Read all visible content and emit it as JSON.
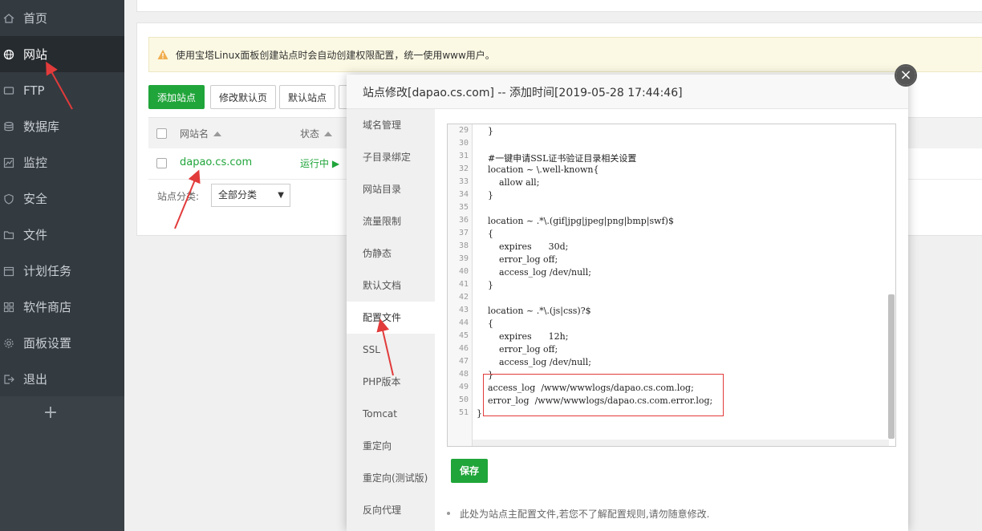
{
  "sidebar": {
    "items": [
      {
        "label": "首页",
        "icon": "home-icon"
      },
      {
        "label": "网站",
        "icon": "globe-icon"
      },
      {
        "label": "FTP",
        "icon": "ftp-icon"
      },
      {
        "label": "数据库",
        "icon": "database-icon"
      },
      {
        "label": "监控",
        "icon": "monitor-icon"
      },
      {
        "label": "安全",
        "icon": "shield-icon"
      },
      {
        "label": "文件",
        "icon": "folder-icon"
      },
      {
        "label": "计划任务",
        "icon": "calendar-icon"
      },
      {
        "label": "软件商店",
        "icon": "apps-icon"
      },
      {
        "label": "面板设置",
        "icon": "gear-icon"
      },
      {
        "label": "退出",
        "icon": "logout-icon"
      }
    ],
    "add": "+"
  },
  "notice": {
    "text": "使用宝塔Linux面板创建站点时会自动创建权限配置，统一使用www用户。"
  },
  "toolbar": {
    "add_site": "添加站点",
    "modify_default_page": "修改默认页",
    "default_site": "默认站点"
  },
  "table": {
    "headers": {
      "site_name": "网站名",
      "status": "状态"
    },
    "row": {
      "site": "dapao.cs.com",
      "status": "运行中 ▶"
    }
  },
  "category": {
    "label": "站点分类:",
    "selected": "全部分类"
  },
  "modal": {
    "title": "站点修改[dapao.cs.com] -- 添加时间[2019-05-28 17:44:46]",
    "tabs": [
      "域名管理",
      "子目录绑定",
      "网站目录",
      "流量限制",
      "伪静态",
      "默认文档",
      "配置文件",
      "SSL",
      "PHP版本",
      "Tomcat",
      "重定向",
      "重定向(测试版)",
      "反向代理"
    ],
    "active_tab": "配置文件",
    "editor": {
      "lines": [
        {
          "n": "29",
          "text": "    }"
        },
        {
          "n": "30",
          "text": ""
        },
        {
          "n": "31",
          "text": "    #一键申请SSL证书验证目录相关设置"
        },
        {
          "n": "32",
          "text": "    location ~ \\.well-known{"
        },
        {
          "n": "33",
          "text": "        allow all;"
        },
        {
          "n": "34",
          "text": "    }"
        },
        {
          "n": "35",
          "text": ""
        },
        {
          "n": "36",
          "text": "    location ~ .*\\.(gif|jpg|jpeg|png|bmp|swf)$"
        },
        {
          "n": "37",
          "text": "    {"
        },
        {
          "n": "38",
          "text": "        expires      30d;"
        },
        {
          "n": "39",
          "text": "        error_log off;"
        },
        {
          "n": "40",
          "text": "        access_log /dev/null;"
        },
        {
          "n": "41",
          "text": "    }"
        },
        {
          "n": "42",
          "text": ""
        },
        {
          "n": "43",
          "text": "    location ~ .*\\.(js|css)?$"
        },
        {
          "n": "44",
          "text": "    {"
        },
        {
          "n": "45",
          "text": "        expires      12h;"
        },
        {
          "n": "46",
          "text": "        error_log off;"
        },
        {
          "n": "47",
          "text": "        access_log /dev/null;"
        },
        {
          "n": "48",
          "text": "    }"
        },
        {
          "n": "49",
          "text": "    access_log  /www/wwwlogs/dapao.cs.com.log;"
        },
        {
          "n": "50",
          "text": "    error_log  /www/wwwlogs/dapao.cs.com.error.log;"
        },
        {
          "n": "51",
          "text": "}"
        }
      ]
    },
    "save": "保存",
    "hint": "此处为站点主配置文件,若您不了解配置规则,请勿随意修改."
  },
  "colors": {
    "accent": "#20a53a",
    "annotation": "#e23b3b",
    "sidebar": "#333a40"
  }
}
